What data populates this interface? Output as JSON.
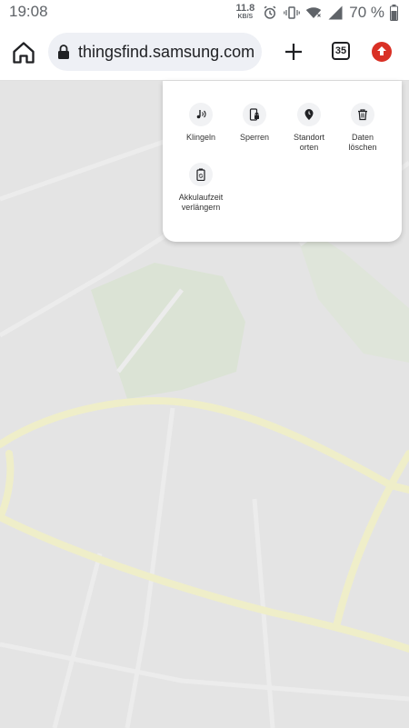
{
  "status_bar": {
    "time": "19:08",
    "net_speed_value": "11.8",
    "net_speed_unit": "KB/S",
    "battery": "70 %"
  },
  "browser": {
    "url": "thingsfind.samsung.com",
    "tab_count": "35"
  },
  "actions": [
    {
      "label": "Klingeln",
      "icon": "ring-icon"
    },
    {
      "label": "Sperren",
      "icon": "lock-phone-icon"
    },
    {
      "label": "Standort\norten",
      "icon": "location-icon"
    },
    {
      "label": "Daten\nlöschen",
      "icon": "trash-icon"
    },
    {
      "label": "Akkulaufzeit\nverlängern",
      "icon": "battery-extend-icon"
    }
  ],
  "colors": {
    "map_bg": "#e4e4e4",
    "map_road": "#f0efc8",
    "map_park": "#dbe6d6",
    "update_red": "#d93025"
  }
}
